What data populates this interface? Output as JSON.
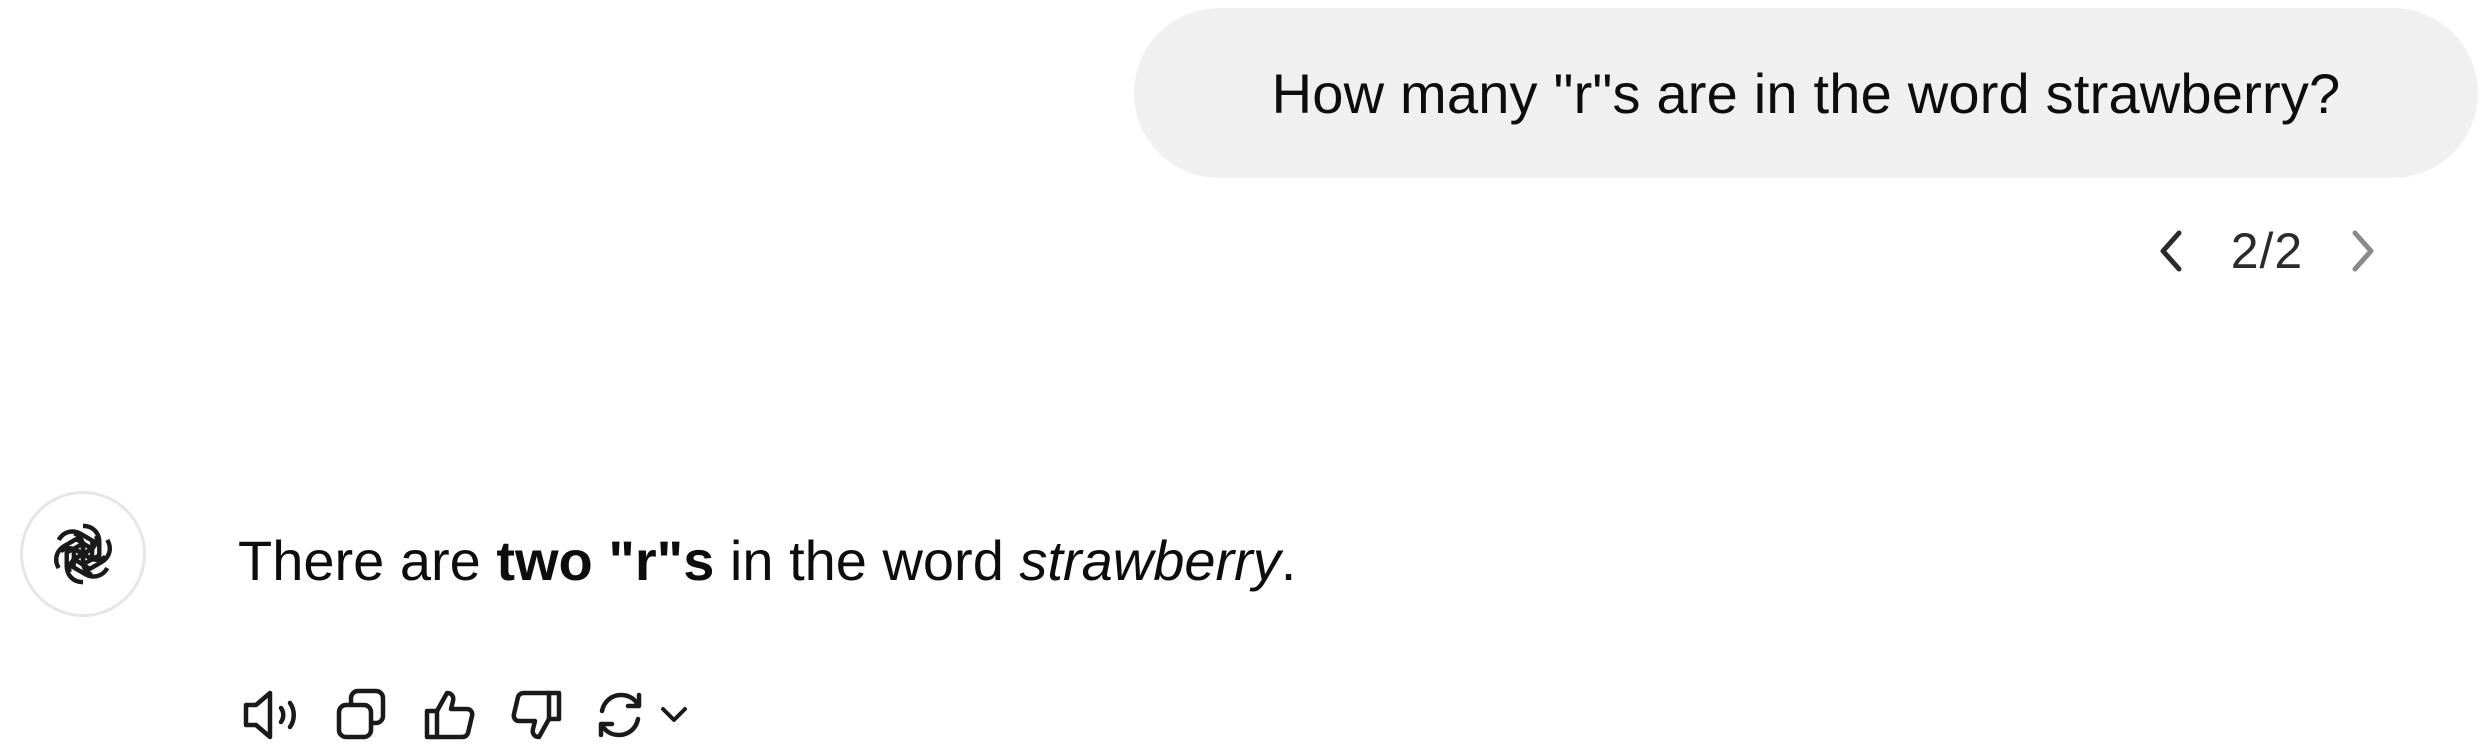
{
  "user_message": {
    "text": "How many \"r\"s are in the word strawberry?"
  },
  "branch_nav": {
    "counter": "2/2",
    "prev_icon": "chevron-left-icon",
    "next_icon": "chevron-right-icon"
  },
  "assistant": {
    "avatar_icon": "openai-logo-icon",
    "response": {
      "part1": "There are ",
      "bold": "two \"r\"s",
      "part2": " in the word ",
      "italic": "strawberry",
      "part3": "."
    }
  },
  "actions": [
    {
      "icon": "read-aloud-icon"
    },
    {
      "icon": "copy-icon"
    },
    {
      "icon": "thumbs-up-icon"
    },
    {
      "icon": "thumbs-down-icon"
    },
    {
      "icon": "regenerate-icon"
    }
  ],
  "colors": {
    "bubble_bg": "#f0f0f0",
    "text": "#0d0d0d",
    "icon": "#5d5d5d",
    "avatar_border": "#e6e6e6"
  }
}
